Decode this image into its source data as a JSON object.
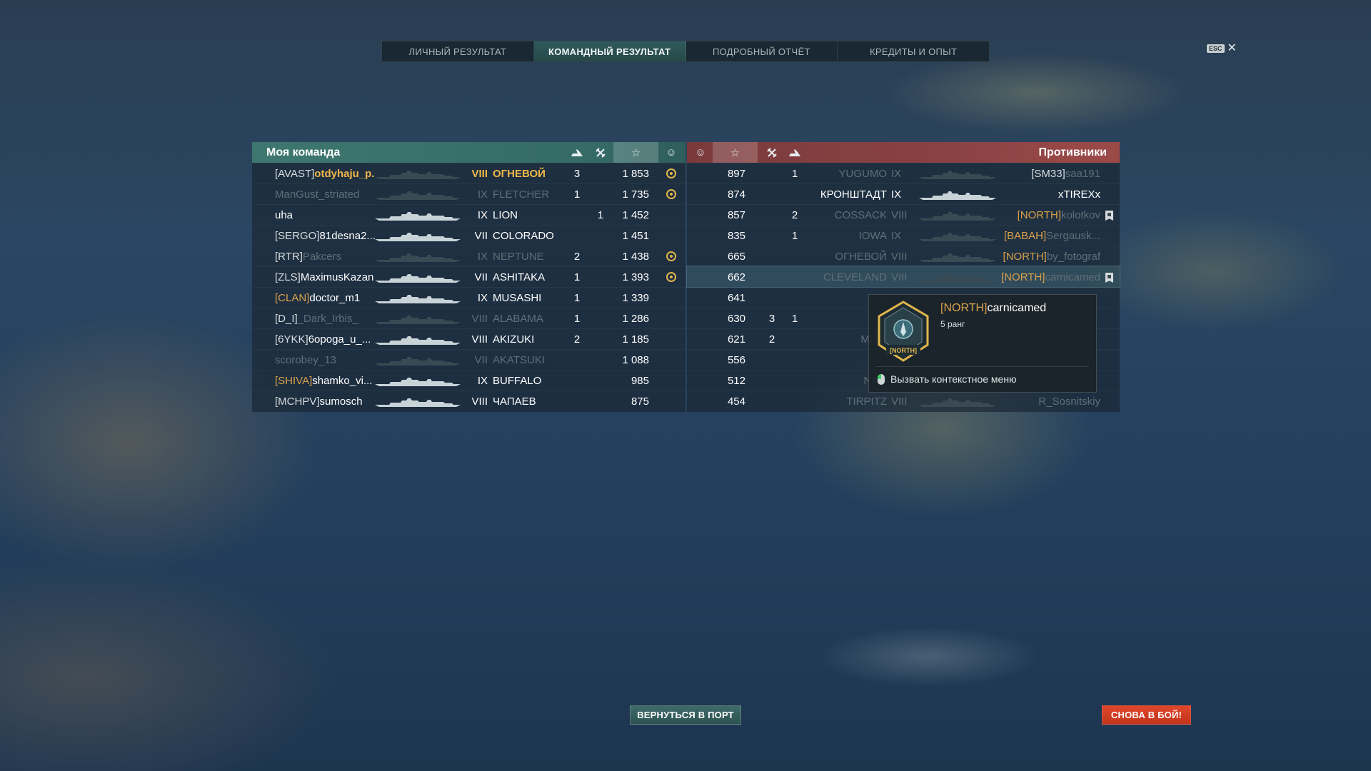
{
  "tabs": [
    {
      "label": "ЛИЧНЫЙ РЕЗУЛЬТАТ",
      "active": false
    },
    {
      "label": "КОМАНДНЫЙ РЕЗУЛЬТАТ",
      "active": true
    },
    {
      "label": "ПОДРОБНЫЙ ОТЧЁТ",
      "active": false
    },
    {
      "label": "КРЕДИТЫ И ОПЫТ",
      "active": false
    }
  ],
  "esc": {
    "key": "ESC",
    "close": "✕"
  },
  "my_team": {
    "title": "Моя команда",
    "header_icons": {
      "planes": "plane-icon",
      "kills": "crossed-swords-icon",
      "score": "☆",
      "medals": "☺"
    },
    "rows": [
      {
        "clan": "[AVAST]",
        "name": "otdyhaju_p...",
        "tier": "VIII",
        "ship": "ОГНЕВОЙ",
        "planes": "3",
        "kills": "",
        "score": "1 853",
        "medal": true,
        "style": "self"
      },
      {
        "clan": "",
        "name": "ManGust_striated",
        "tier": "IX",
        "ship": "FLETCHER",
        "planes": "1",
        "kills": "",
        "score": "1 735",
        "medal": true,
        "style": "dead"
      },
      {
        "clan": "",
        "name": "uha",
        "tier": "IX",
        "ship": "LION",
        "planes": "",
        "kills": "1",
        "score": "1 452",
        "medal": false,
        "style": "alive"
      },
      {
        "clan": "[SERGO]",
        "name": "81desna2...",
        "tier": "VII",
        "ship": "COLORADO",
        "planes": "",
        "kills": "",
        "score": "1 451",
        "medal": false,
        "style": "alive"
      },
      {
        "clan": "[RTR]",
        "name": "Pakcers",
        "tier": "IX",
        "ship": "NEPTUNE",
        "planes": "2",
        "kills": "",
        "score": "1 438",
        "medal": true,
        "style": "dead-name"
      },
      {
        "clan": "[ZLS]",
        "name": "MaximusKazan",
        "tier": "VII",
        "ship": "ASHITAKA",
        "planes": "1",
        "kills": "",
        "score": "1 393",
        "medal": true,
        "style": "alive"
      },
      {
        "clan": "[CLAN]",
        "name": "doctor_m1",
        "tier": "IX",
        "ship": "MUSASHI",
        "planes": "1",
        "kills": "",
        "score": "1 339",
        "medal": false,
        "style": "gold-clan"
      },
      {
        "clan": "[D_I]",
        "name": "_Dark_Irbis_",
        "tier": "VIII",
        "ship": "ALABAMA",
        "planes": "1",
        "kills": "",
        "score": "1 286",
        "medal": false,
        "style": "dead-name"
      },
      {
        "clan": "[6YKK]",
        "name": "6opoga_u_...",
        "tier": "VIII",
        "ship": "AKIZUKI",
        "planes": "2",
        "kills": "",
        "score": "1 185",
        "medal": false,
        "style": "alive"
      },
      {
        "clan": "",
        "name": "scorobey_13",
        "tier": "VII",
        "ship": "AKATSUKI",
        "planes": "",
        "kills": "",
        "score": "1 088",
        "medal": false,
        "style": "dead"
      },
      {
        "clan": "[SHIVA]",
        "name": "shamko_vi...",
        "tier": "IX",
        "ship": "BUFFALO",
        "planes": "",
        "kills": "",
        "score": "985",
        "medal": false,
        "style": "gold-clan"
      },
      {
        "clan": "[MCHPV]",
        "name": "sumosch",
        "tier": "VIII",
        "ship": "ЧАПАЕВ",
        "planes": "",
        "kills": "",
        "score": "875",
        "medal": false,
        "style": "alive"
      }
    ]
  },
  "enemies": {
    "title": "Противники",
    "rows": [
      {
        "score": "897",
        "kills": "",
        "planes": "1",
        "ship": "YUGUMO",
        "tier": "IX",
        "clan": "[SM33]",
        "name": "saa191",
        "style": "dead-name",
        "flag": false
      },
      {
        "score": "874",
        "kills": "",
        "planes": "",
        "ship": "КРОНШТАДТ",
        "tier": "IX",
        "clan": "",
        "name": "xTIREXx",
        "style": "alive",
        "flag": false
      },
      {
        "score": "857",
        "kills": "",
        "planes": "2",
        "ship": "COSSACK",
        "tier": "VIII",
        "clan": "[NORTH]",
        "name": "kolotkov",
        "style": "dead-name",
        "flag": true
      },
      {
        "score": "835",
        "kills": "",
        "planes": "1",
        "ship": "IOWA",
        "tier": "IX",
        "clan": "[BABAH]",
        "name": "Sergausk...",
        "style": "dead-name",
        "flag": false
      },
      {
        "score": "665",
        "kills": "",
        "planes": "",
        "ship": "ОГНЕВОЙ",
        "tier": "VIII",
        "clan": "[NORTH]",
        "name": "by_fotograf",
        "style": "dead-name",
        "flag": false
      },
      {
        "score": "662",
        "kills": "",
        "planes": "",
        "ship": "CLEVELAND",
        "tier": "VIII",
        "clan": "[NORTH]",
        "name": "carnicamed",
        "style": "dead-name",
        "flag": true,
        "highlight": true
      },
      {
        "score": "641",
        "kills": "",
        "planes": "",
        "ship": "S",
        "tier": "",
        "clan": "",
        "name": "",
        "style": "dead",
        "flag": false
      },
      {
        "score": "630",
        "kills": "3",
        "planes": "1",
        "ship": "",
        "tier": "",
        "clan": "",
        "name": "",
        "style": "dead",
        "flag": false
      },
      {
        "score": "621",
        "kills": "2",
        "planes": "",
        "ship": "MISS",
        "tier": "",
        "clan": "",
        "name": "",
        "style": "dead",
        "flag": false
      },
      {
        "score": "556",
        "kills": "",
        "planes": "",
        "ship": "",
        "tier": "",
        "clan": "",
        "name": "",
        "style": "dead",
        "flag": false
      },
      {
        "score": "512",
        "kills": "",
        "planes": "",
        "ship": "NAG",
        "tier": "",
        "clan": "",
        "name": "",
        "style": "dead",
        "flag": false
      },
      {
        "score": "454",
        "kills": "",
        "planes": "",
        "ship": "TIRPITZ",
        "tier": "VIII",
        "clan": "",
        "name": "R_Sosnitskiy",
        "style": "dead",
        "flag": false
      }
    ]
  },
  "tooltip": {
    "clan": "[NORTH]",
    "name": "carnicamed",
    "rank": "5 ранг",
    "badge_text": "[NORTH]",
    "action": "Вызвать контекстное меню"
  },
  "buttons": {
    "port": "ВЕРНУТЬСЯ В ПОРТ",
    "again": "СНОВА В БОЙ!"
  },
  "colors": {
    "accent_teal": "#3e7770",
    "enemy_red": "#8a4244",
    "gold": "#d9a14b",
    "battle_btn": "#d63f24"
  }
}
